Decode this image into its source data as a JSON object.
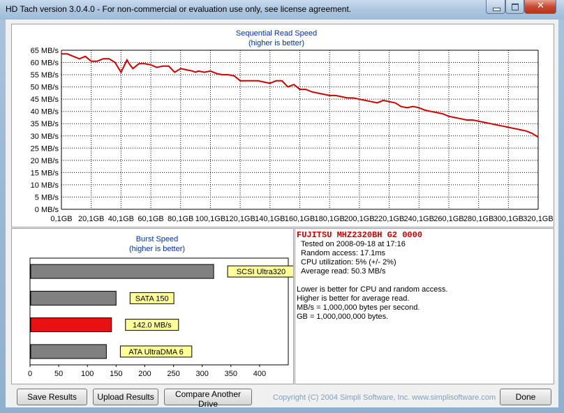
{
  "window": {
    "title": "HD Tach version 3.0.4.0  - For non-commercial or evaluation use only, see license agreement."
  },
  "sequential": {
    "title": "Sequential Read Speed",
    "subtitle": "(higher is better)",
    "line_color": "#cc0000"
  },
  "chart_data": [
    {
      "type": "line",
      "title": "Sequential Read Speed",
      "subtitle": "(higher is better)",
      "x_tick_labels": [
        "0,1GB",
        "20,1GB",
        "40,1GB",
        "60,1GB",
        "80,1GB",
        "100,1GB",
        "120,1GB",
        "140,1GB",
        "160,1GB",
        "180,1GB",
        "200,1GB",
        "220,1GB",
        "240,1GB",
        "260,1GB",
        "280,1GB",
        "300,1GB",
        "320,1GB"
      ],
      "y_tick_labels": [
        "65 MB/s",
        "60 MB/s",
        "55 MB/s",
        "50 MB/s",
        "45 MB/s",
        "40 MB/s",
        "35 MB/s",
        "30 MB/s",
        "25 MB/s",
        "20 MB/s",
        "15 MB/s",
        "10 MB/s",
        "5 MB/s",
        "0 MB/s"
      ],
      "xlim": [
        0,
        320
      ],
      "ylim": [
        0,
        65
      ],
      "grid": true,
      "series": [
        {
          "x": [
            0,
            4,
            8,
            12,
            16,
            20,
            24,
            28,
            32,
            36,
            40,
            44,
            46,
            48,
            50,
            52,
            56,
            60,
            64,
            68,
            70,
            72,
            76,
            80,
            84,
            88,
            90,
            92,
            96,
            100,
            104,
            108,
            112,
            116,
            120,
            124,
            128,
            132,
            136,
            140,
            144,
            148,
            152,
            156,
            160,
            164,
            168,
            172,
            176,
            180,
            184,
            188,
            192,
            196,
            200,
            204,
            208,
            212,
            216,
            220,
            224,
            228,
            232,
            236,
            240,
            244,
            248,
            252,
            256,
            260,
            264,
            268,
            272,
            276,
            280,
            284,
            288,
            292,
            296,
            300,
            304,
            308,
            312,
            316,
            320
          ],
          "y": [
            63.5,
            63.5,
            62.5,
            61.5,
            62.5,
            60.5,
            60.5,
            61.5,
            61.5,
            60,
            56,
            61,
            59,
            57.5,
            58.5,
            59.5,
            59.5,
            59,
            58,
            58.5,
            58.5,
            58.5,
            56,
            57.5,
            57,
            56.5,
            56,
            56.5,
            56,
            56.5,
            55.5,
            55,
            55,
            54.5,
            52.5,
            52.5,
            52.5,
            52.5,
            52,
            51.5,
            52.5,
            52.5,
            50,
            51,
            49,
            49,
            48,
            47.5,
            47,
            46.5,
            46.5,
            46,
            45.5,
            45.5,
            45,
            44.5,
            44,
            43.5,
            44.5,
            44,
            43.5,
            42,
            41.5,
            42,
            41.5,
            40.5,
            40,
            39.5,
            39,
            38,
            37.5,
            37,
            36.5,
            36.5,
            36,
            35.5,
            35,
            34.5,
            34,
            33.5,
            33,
            32.5,
            32,
            31,
            29.5
          ]
        }
      ]
    },
    {
      "type": "bar",
      "orientation": "horizontal",
      "title": "Burst Speed",
      "subtitle": "(higher is better)",
      "x_tick_labels": [
        "0",
        "50",
        "100",
        "150",
        "200",
        "250",
        "300",
        "350",
        "400"
      ],
      "xlim": [
        0,
        450
      ],
      "grid": false,
      "categories": [
        "SCSI Ultra320",
        "SATA 150",
        "142.0 MB/s",
        "ATA UltraDMA 6"
      ],
      "values": [
        320,
        150,
        142,
        133
      ],
      "colors": [
        "#808080",
        "#808080",
        "#e81010",
        "#808080"
      ]
    }
  ],
  "burst": {
    "title": "Burst Speed",
    "subtitle": "(higher is better)"
  },
  "info": {
    "drive": "FUJITSU MHZ2320BH G2 0000",
    "tested": "Tested on 2008-09-18 at 17:16",
    "random_access": "Random access: 17.1ms",
    "cpu": "CPU utilization: 5% (+/- 2%)",
    "average": "Average read: 50.3 MB/s",
    "notes": [
      "Lower is better for CPU and random access.",
      "Higher is better for average read.",
      "MB/s = 1,000,000 bytes per second.",
      "GB = 1,000,000,000 bytes."
    ]
  },
  "buttons": {
    "save": "Save Results",
    "upload": "Upload Results",
    "compare": "Compare Another Drive",
    "done": "Done"
  },
  "footer": {
    "copyright": "Copyright (C) 2004 Simpli Software, Inc. www.simplisoftware.com"
  }
}
